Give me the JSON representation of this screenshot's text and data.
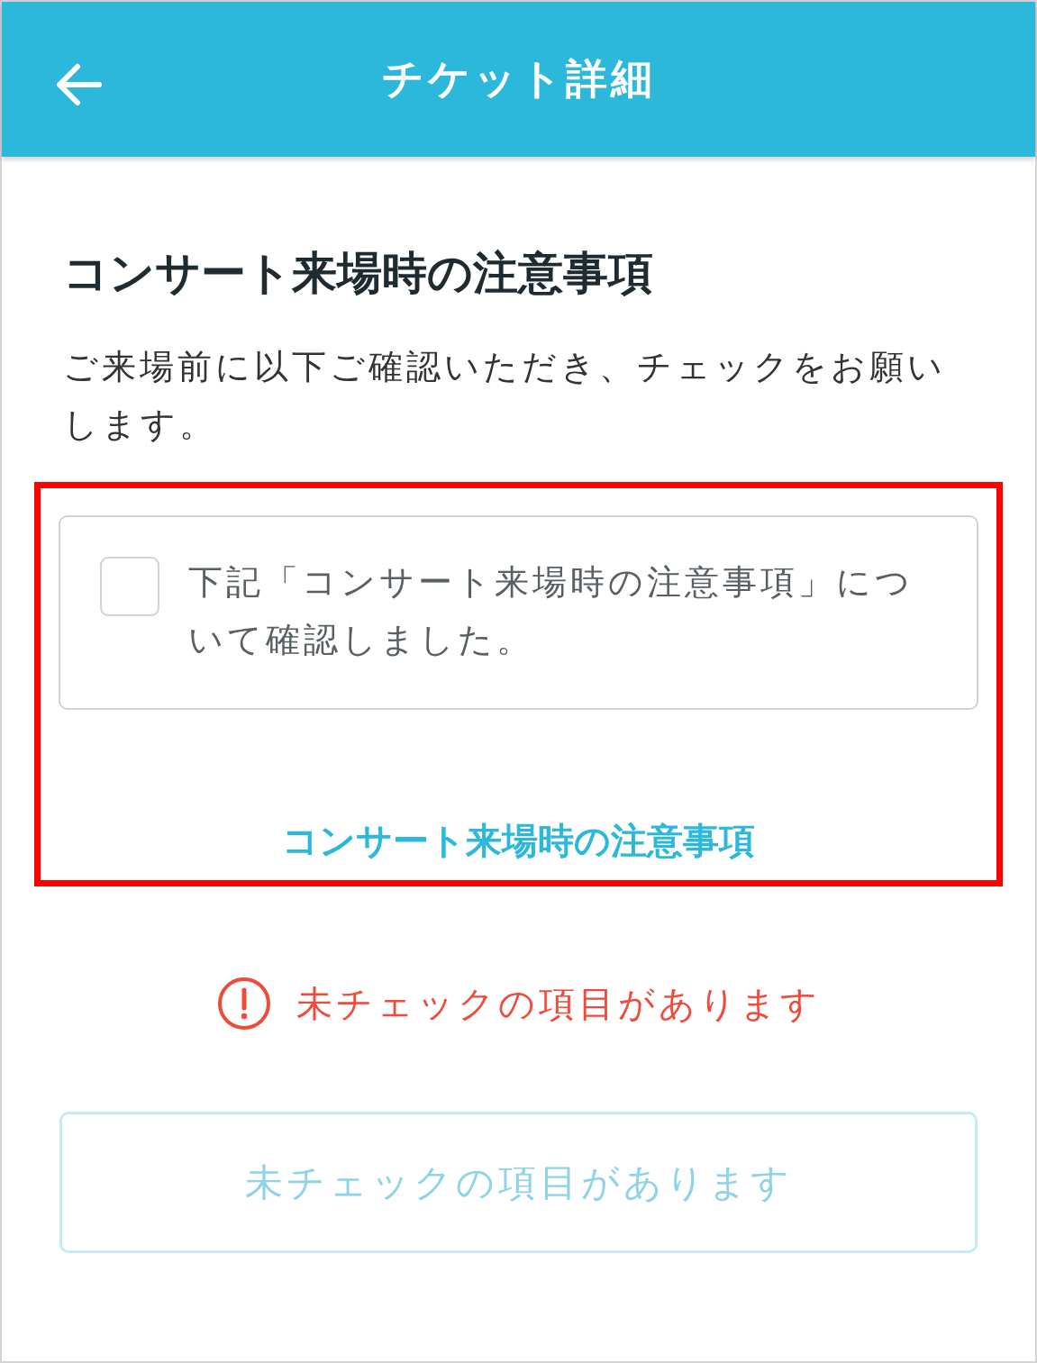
{
  "header": {
    "title": "チケット詳細"
  },
  "heading": "コンサート来場時の注意事項",
  "description": "ご来場前に以下ご確認いただき、チェックをお願いします。",
  "confirmation": {
    "label": "下記「コンサート来場時の注意事項」について確認しました。",
    "checked": false
  },
  "link": "コンサート来場時の注意事項",
  "error": {
    "message": "未チェックの項目があります"
  },
  "submit_button": {
    "label": "未チェックの項目があります",
    "disabled": true
  }
}
